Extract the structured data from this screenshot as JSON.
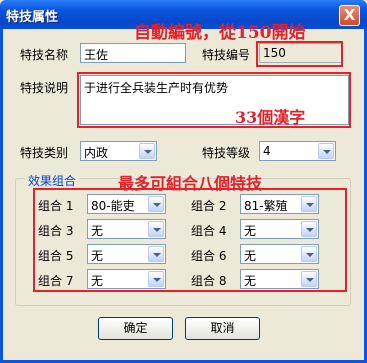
{
  "window": {
    "title": "特技属性",
    "close_label": "X"
  },
  "fields": {
    "name_label": "特技名称",
    "name_value": "王佐",
    "id_label": "特技编号",
    "id_value": "150",
    "desc_label": "特技说明",
    "desc_value": "于进行全兵装生产时有优势",
    "category_label": "特技类别",
    "category_value": "内政",
    "level_label": "特技等级",
    "level_value": "4"
  },
  "effect_group": {
    "title": "效果组合",
    "combos": [
      {
        "label": "组合 1",
        "value": "80-能吏"
      },
      {
        "label": "组合 2",
        "value": "81-繁殖"
      },
      {
        "label": "组合 3",
        "value": "无"
      },
      {
        "label": "组合 4",
        "value": "无"
      },
      {
        "label": "组合 5",
        "value": "无"
      },
      {
        "label": "组合 6",
        "value": "无"
      },
      {
        "label": "组合 7",
        "value": "无"
      },
      {
        "label": "组合 8",
        "value": "无"
      }
    ]
  },
  "buttons": {
    "ok": "确定",
    "cancel": "取消"
  },
  "annotations": {
    "auto_number": "自動編號，從150開始",
    "char_limit": "33個漢字",
    "max_combos": "最多可組合八個特技",
    "color": "#e8202a"
  }
}
